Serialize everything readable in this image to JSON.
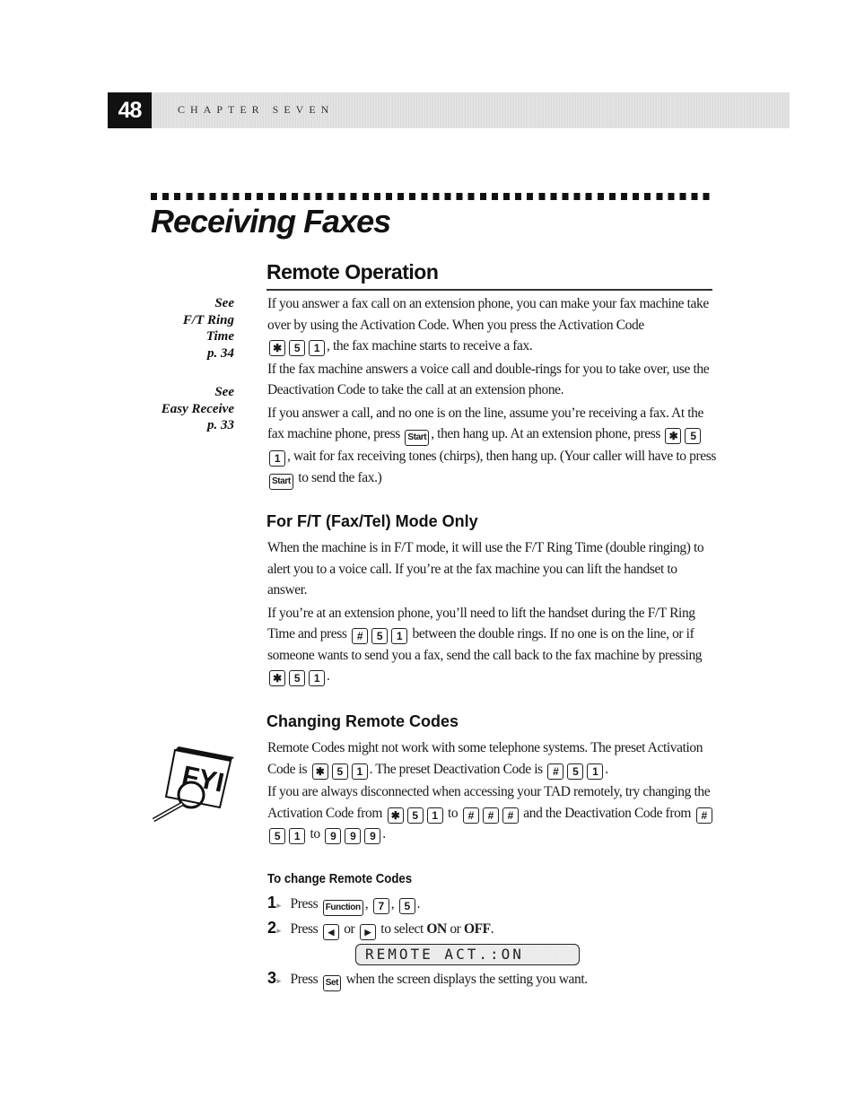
{
  "header": {
    "page_number": "48",
    "chapter": "CHAPTER SEVEN"
  },
  "title": "Receiving Faxes",
  "sections": {
    "remote_operation": {
      "heading": "Remote Operation",
      "margin_notes": [
        {
          "lines": [
            "See",
            "F/T Ring",
            "Time",
            "p. 34"
          ]
        },
        {
          "lines": [
            "See",
            "Easy Receive",
            "p. 33"
          ]
        }
      ],
      "p1_a": "If you answer a fax call on an extension phone, you can make your fax machine take over by using the Activation Code. When you press the Activation Code",
      "p1_b": ", the fax machine starts to receive a fax.",
      "p2": "If the fax machine answers a voice call and double-rings for you to take over, use the Deactivation Code to take the call at an extension phone.",
      "p3_a": "If you answer a call, and no one is on the line, assume you’re receiving a fax. At the fax machine phone, press",
      "p3_b": ", then hang up. At an extension phone, press",
      "p3_c": ", wait for fax receiving tones (chirps), then hang up. (Your caller will have to press",
      "p3_d": "to send the fax.)"
    },
    "ft_mode": {
      "heading": "For F/T (Fax/Tel) Mode Only",
      "p1": "When the machine is in F/T mode, it will use the F/T Ring Time (double ringing) to alert you to a voice call. If you’re at the fax machine you can lift the handset to answer.",
      "p2_a": "If you’re at an extension phone, you’ll need to lift the handset during the F/T Ring Time and press",
      "p2_b": "between the double rings. If no one is on the line, or if someone wants to send you a fax, send the call back to the fax machine by pressing",
      "p2_c": "."
    },
    "changing_codes": {
      "heading": "Changing Remote Codes",
      "fyi_label": "FYI",
      "p1_a": "Remote Codes might not work with some telephone systems. The preset Activation Code is",
      "p1_b": ". The preset Deactivation Code is",
      "p1_c": ".",
      "p2_a": "If you are always disconnected when accessing your TAD remotely, try changing the Activation Code from",
      "p2_b": "to",
      "p2_c": "and the Deactivation Code from",
      "p2_d": "to",
      "p2_e": "."
    },
    "to_change": {
      "heading": "To change Remote Codes",
      "steps": [
        {
          "num": "1",
          "a": "Press",
          "b": ",",
          "c": ",",
          "d": "."
        },
        {
          "num": "2",
          "a": "Press",
          "b": "or",
          "c": "to select",
          "on": "ON",
          "or": "or",
          "off": "OFF",
          "d": "."
        },
        {
          "num": "3",
          "a": "Press",
          "b": "when the screen displays the setting you want."
        }
      ],
      "lcd_display": "REMOTE ACT.:ON"
    }
  },
  "keys": {
    "star": "✱",
    "hash": "#",
    "five": "5",
    "one": "1",
    "seven": "7",
    "nine": "9",
    "start": "Start",
    "function": "Function",
    "set": "Set",
    "left": "◀",
    "right": "▶"
  }
}
